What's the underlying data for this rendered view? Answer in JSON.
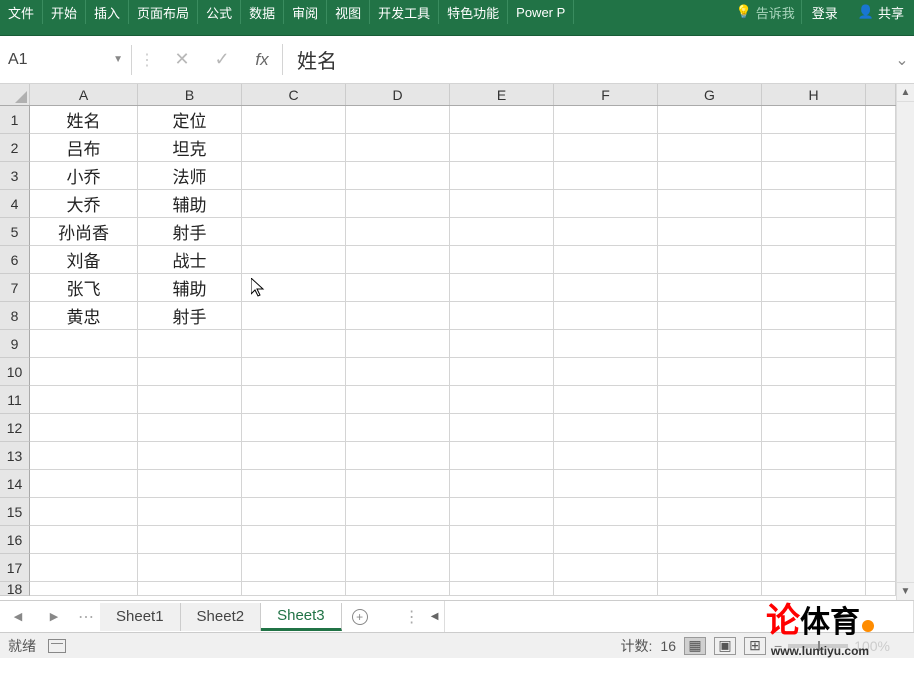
{
  "ribbon": {
    "tabs": [
      "文件",
      "开始",
      "插入",
      "页面布局",
      "公式",
      "数据",
      "审阅",
      "视图",
      "开发工具",
      "特色功能",
      "Power P"
    ],
    "tell_me": "告诉我",
    "login": "登录",
    "share": "共享"
  },
  "formula_bar": {
    "name_box": "A1",
    "content": "姓名"
  },
  "columns": [
    "A",
    "B",
    "C",
    "D",
    "E",
    "F",
    "G",
    "H"
  ],
  "rows": [
    "1",
    "2",
    "3",
    "4",
    "5",
    "6",
    "7",
    "8",
    "9",
    "10",
    "11",
    "12",
    "13",
    "14",
    "15",
    "16",
    "17",
    "18"
  ],
  "data": {
    "r0": {
      "a": "姓名",
      "b": "定位"
    },
    "r1": {
      "a": "吕布",
      "b": "坦克"
    },
    "r2": {
      "a": "小乔",
      "b": "法师"
    },
    "r3": {
      "a": "大乔",
      "b": "辅助"
    },
    "r4": {
      "a": "孙尚香",
      "b": "射手"
    },
    "r5": {
      "a": "刘备",
      "b": "战士"
    },
    "r6": {
      "a": "张飞",
      "b": "辅助"
    },
    "r7": {
      "a": "黄忠",
      "b": "射手"
    }
  },
  "sheet_tabs": {
    "s1": "Sheet1",
    "s2": "Sheet2",
    "s3": "Sheet3"
  },
  "status": {
    "ready": "就绪",
    "count_label": "计数:",
    "count_value": "16",
    "zoom": "100%"
  },
  "watermark": {
    "lun": "论",
    "tiyu": "体育",
    "url": "www.luntiyu.com"
  }
}
